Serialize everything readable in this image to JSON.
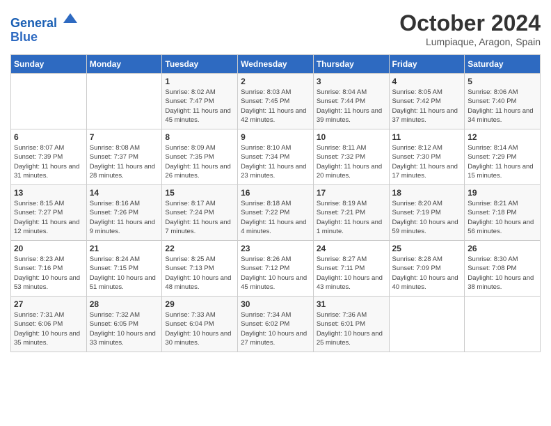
{
  "header": {
    "logo_line1": "General",
    "logo_line2": "Blue",
    "month": "October 2024",
    "location": "Lumpiaque, Aragon, Spain"
  },
  "days_of_week": [
    "Sunday",
    "Monday",
    "Tuesday",
    "Wednesday",
    "Thursday",
    "Friday",
    "Saturday"
  ],
  "weeks": [
    [
      {
        "day": "",
        "info": ""
      },
      {
        "day": "",
        "info": ""
      },
      {
        "day": "1",
        "info": "Sunrise: 8:02 AM\nSunset: 7:47 PM\nDaylight: 11 hours and 45 minutes."
      },
      {
        "day": "2",
        "info": "Sunrise: 8:03 AM\nSunset: 7:45 PM\nDaylight: 11 hours and 42 minutes."
      },
      {
        "day": "3",
        "info": "Sunrise: 8:04 AM\nSunset: 7:44 PM\nDaylight: 11 hours and 39 minutes."
      },
      {
        "day": "4",
        "info": "Sunrise: 8:05 AM\nSunset: 7:42 PM\nDaylight: 11 hours and 37 minutes."
      },
      {
        "day": "5",
        "info": "Sunrise: 8:06 AM\nSunset: 7:40 PM\nDaylight: 11 hours and 34 minutes."
      }
    ],
    [
      {
        "day": "6",
        "info": "Sunrise: 8:07 AM\nSunset: 7:39 PM\nDaylight: 11 hours and 31 minutes."
      },
      {
        "day": "7",
        "info": "Sunrise: 8:08 AM\nSunset: 7:37 PM\nDaylight: 11 hours and 28 minutes."
      },
      {
        "day": "8",
        "info": "Sunrise: 8:09 AM\nSunset: 7:35 PM\nDaylight: 11 hours and 26 minutes."
      },
      {
        "day": "9",
        "info": "Sunrise: 8:10 AM\nSunset: 7:34 PM\nDaylight: 11 hours and 23 minutes."
      },
      {
        "day": "10",
        "info": "Sunrise: 8:11 AM\nSunset: 7:32 PM\nDaylight: 11 hours and 20 minutes."
      },
      {
        "day": "11",
        "info": "Sunrise: 8:12 AM\nSunset: 7:30 PM\nDaylight: 11 hours and 17 minutes."
      },
      {
        "day": "12",
        "info": "Sunrise: 8:14 AM\nSunset: 7:29 PM\nDaylight: 11 hours and 15 minutes."
      }
    ],
    [
      {
        "day": "13",
        "info": "Sunrise: 8:15 AM\nSunset: 7:27 PM\nDaylight: 11 hours and 12 minutes."
      },
      {
        "day": "14",
        "info": "Sunrise: 8:16 AM\nSunset: 7:26 PM\nDaylight: 11 hours and 9 minutes."
      },
      {
        "day": "15",
        "info": "Sunrise: 8:17 AM\nSunset: 7:24 PM\nDaylight: 11 hours and 7 minutes."
      },
      {
        "day": "16",
        "info": "Sunrise: 8:18 AM\nSunset: 7:22 PM\nDaylight: 11 hours and 4 minutes."
      },
      {
        "day": "17",
        "info": "Sunrise: 8:19 AM\nSunset: 7:21 PM\nDaylight: 11 hours and 1 minute."
      },
      {
        "day": "18",
        "info": "Sunrise: 8:20 AM\nSunset: 7:19 PM\nDaylight: 10 hours and 59 minutes."
      },
      {
        "day": "19",
        "info": "Sunrise: 8:21 AM\nSunset: 7:18 PM\nDaylight: 10 hours and 56 minutes."
      }
    ],
    [
      {
        "day": "20",
        "info": "Sunrise: 8:23 AM\nSunset: 7:16 PM\nDaylight: 10 hours and 53 minutes."
      },
      {
        "day": "21",
        "info": "Sunrise: 8:24 AM\nSunset: 7:15 PM\nDaylight: 10 hours and 51 minutes."
      },
      {
        "day": "22",
        "info": "Sunrise: 8:25 AM\nSunset: 7:13 PM\nDaylight: 10 hours and 48 minutes."
      },
      {
        "day": "23",
        "info": "Sunrise: 8:26 AM\nSunset: 7:12 PM\nDaylight: 10 hours and 45 minutes."
      },
      {
        "day": "24",
        "info": "Sunrise: 8:27 AM\nSunset: 7:11 PM\nDaylight: 10 hours and 43 minutes."
      },
      {
        "day": "25",
        "info": "Sunrise: 8:28 AM\nSunset: 7:09 PM\nDaylight: 10 hours and 40 minutes."
      },
      {
        "day": "26",
        "info": "Sunrise: 8:30 AM\nSunset: 7:08 PM\nDaylight: 10 hours and 38 minutes."
      }
    ],
    [
      {
        "day": "27",
        "info": "Sunrise: 7:31 AM\nSunset: 6:06 PM\nDaylight: 10 hours and 35 minutes."
      },
      {
        "day": "28",
        "info": "Sunrise: 7:32 AM\nSunset: 6:05 PM\nDaylight: 10 hours and 33 minutes."
      },
      {
        "day": "29",
        "info": "Sunrise: 7:33 AM\nSunset: 6:04 PM\nDaylight: 10 hours and 30 minutes."
      },
      {
        "day": "30",
        "info": "Sunrise: 7:34 AM\nSunset: 6:02 PM\nDaylight: 10 hours and 27 minutes."
      },
      {
        "day": "31",
        "info": "Sunrise: 7:36 AM\nSunset: 6:01 PM\nDaylight: 10 hours and 25 minutes."
      },
      {
        "day": "",
        "info": ""
      },
      {
        "day": "",
        "info": ""
      }
    ]
  ]
}
